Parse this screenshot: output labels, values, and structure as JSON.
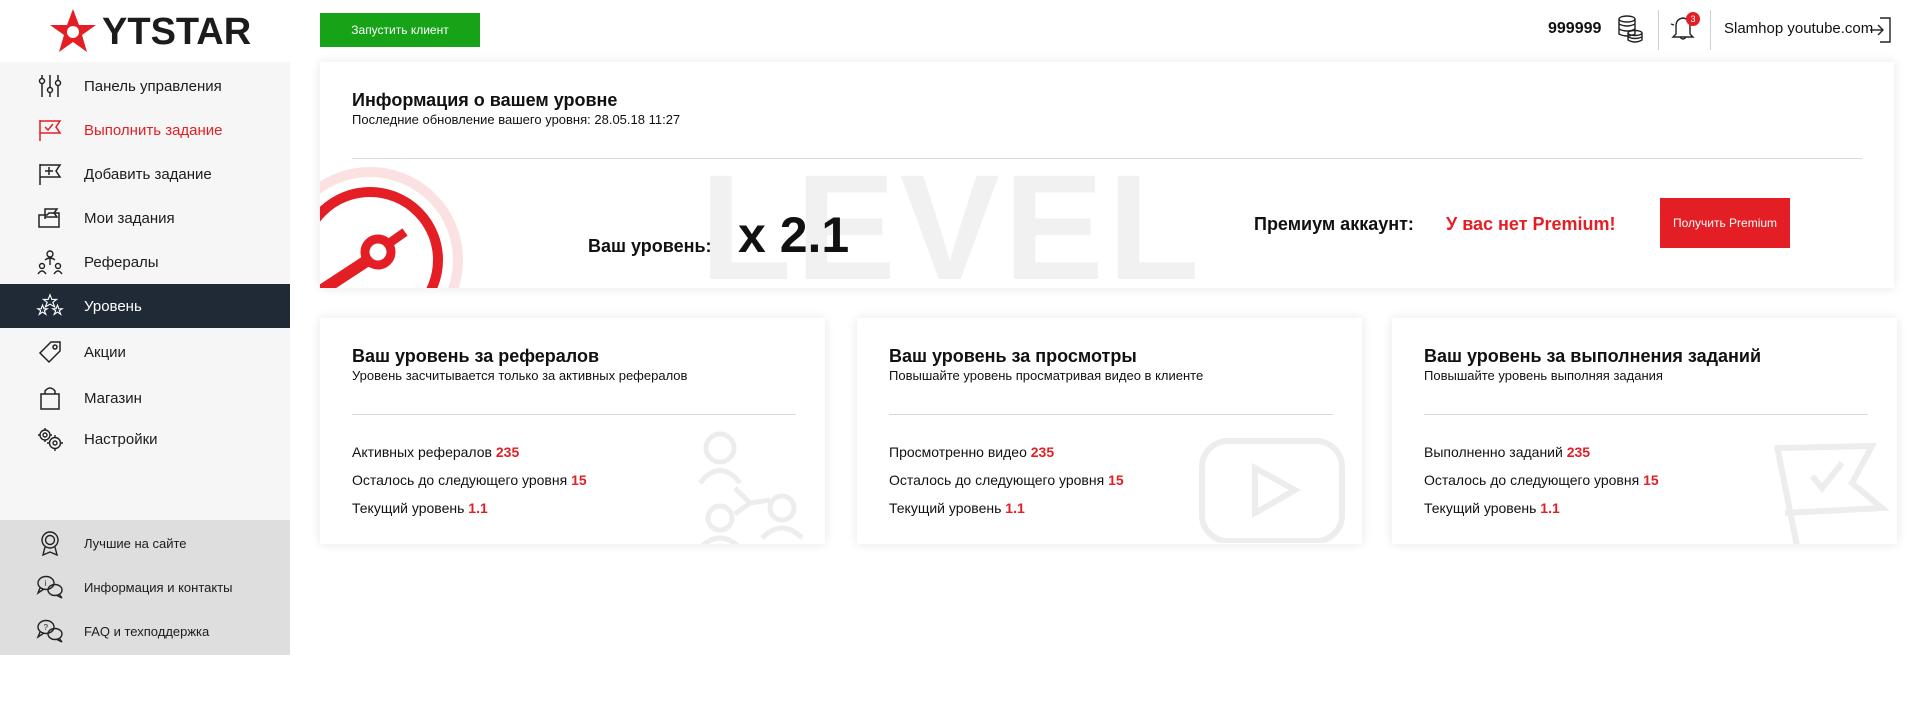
{
  "logo": {
    "text_prefix": "YT",
    "text_suffix": "STAR"
  },
  "sidebar": {
    "items": [
      {
        "label": "Панель управления",
        "icon": "sliders-icon"
      },
      {
        "label": "Выполнить задание",
        "icon": "flag-check-icon"
      },
      {
        "label": "Добавить задание",
        "icon": "flag-plus-icon"
      },
      {
        "label": "Мои задания",
        "icon": "folder-flag-icon"
      },
      {
        "label": "Рефералы",
        "icon": "referrals-icon"
      },
      {
        "label": "Уровень",
        "icon": "stars-icon"
      },
      {
        "label": "Акции",
        "icon": "tag-icon"
      },
      {
        "label": "Магазин",
        "icon": "bag-icon"
      },
      {
        "label": "Настройки",
        "icon": "gears-icon"
      }
    ],
    "bottom_items": [
      {
        "label": "Лучшие на сайте",
        "icon": "award-icon"
      },
      {
        "label": "Информация и контакты",
        "icon": "info-chat-icon"
      },
      {
        "label": "FAQ и техподдержка",
        "icon": "faq-chat-icon"
      }
    ]
  },
  "header": {
    "launch_button": "Запустить клиент",
    "balance": "999999",
    "notifications_count": "3",
    "username": "Slamhop youtube.com"
  },
  "level_card": {
    "title": "Информация о вашем уровне",
    "subtitle": "Последние обновление вашего уровня: 28.05.18 11:27",
    "bg_word": "LEVEL",
    "level_label": "Ваш уровень:",
    "level_value": "x 2.1",
    "premium_label": "Премиум аккаунт:",
    "premium_value": "У вас нет Premium!",
    "premium_button": "Получить Premium"
  },
  "stat_cards": [
    {
      "title": "Ваш уровень за рефералов",
      "subtitle": "Уровень засчитывается только за активных рефералов",
      "lines": [
        {
          "label": "Активных рефералов",
          "value": "235"
        },
        {
          "label": "Осталось до следующего уровня",
          "value": "15"
        },
        {
          "label": "Текущий уровень",
          "value": "1.1"
        }
      ]
    },
    {
      "title": "Ваш уровень за просмотры",
      "subtitle": "Повышайте уровень просматривая видео в клиенте",
      "lines": [
        {
          "label": "Просмотренно видео",
          "value": "235"
        },
        {
          "label": "Осталось до следующего уровня",
          "value": "15"
        },
        {
          "label": "Текущий уровень",
          "value": "1.1"
        }
      ]
    },
    {
      "title": "Ваш уровень за выполнения заданий",
      "subtitle": "Повышайте уровень выполняя задания",
      "lines": [
        {
          "label": "Выполненно заданий",
          "value": "235"
        },
        {
          "label": "Осталось до следующего уровня",
          "value": "15"
        },
        {
          "label": "Текущий уровень",
          "value": "1.1"
        }
      ]
    }
  ],
  "colors": {
    "accent": "#e31e24",
    "green": "#17a317",
    "active_nav": "#1f2a36"
  }
}
